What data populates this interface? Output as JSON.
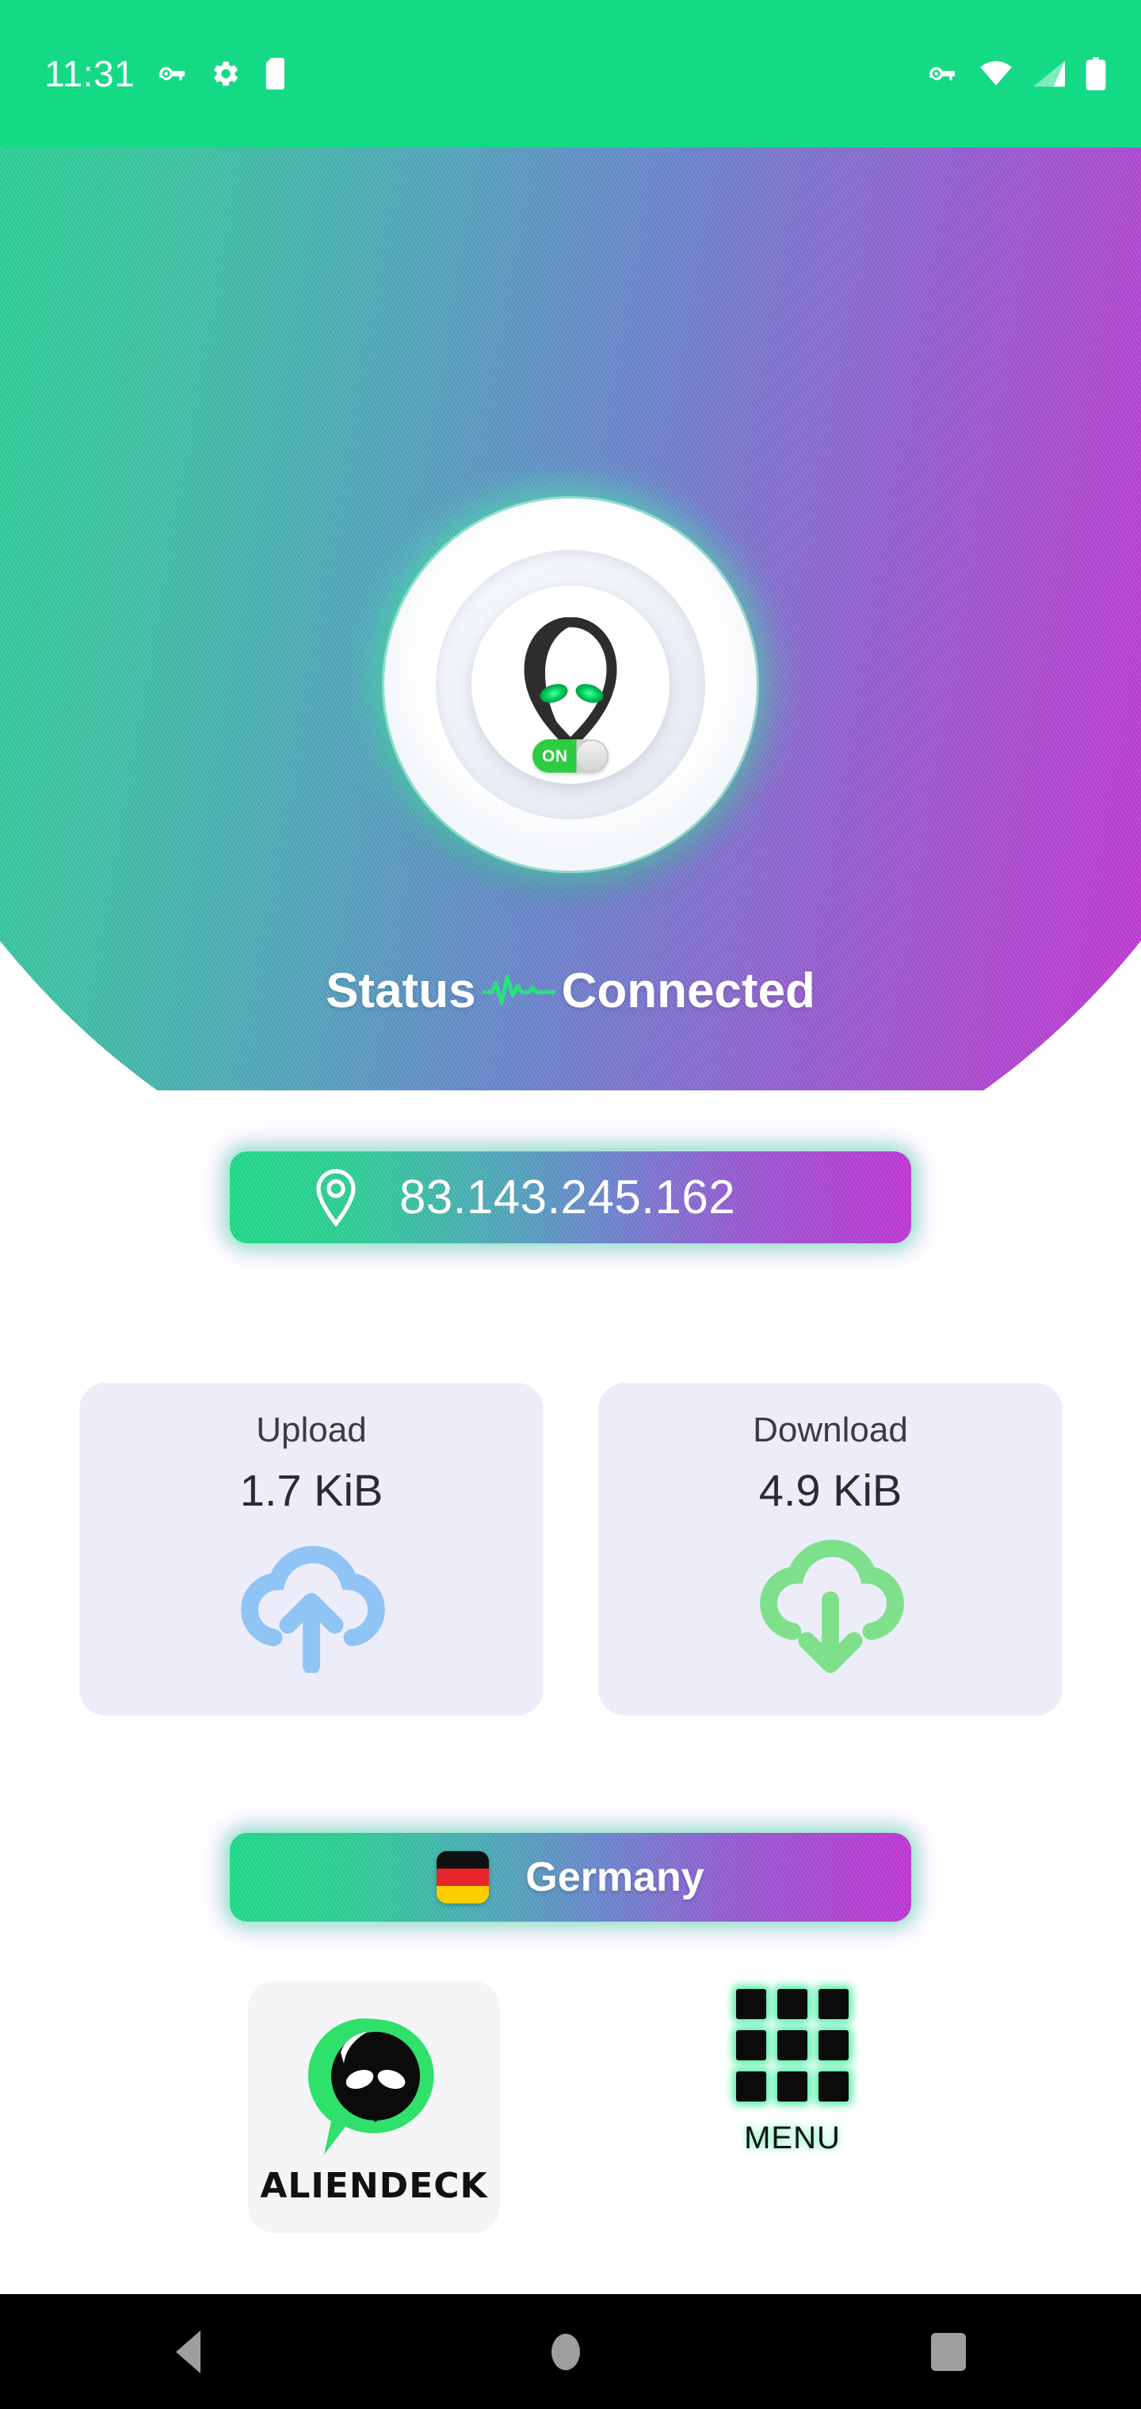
{
  "status_bar": {
    "time": "11:31",
    "left_icons": [
      "vpn-key-icon",
      "settings-gear-icon",
      "sd-card-icon"
    ],
    "right_icons": [
      "vpn-key-icon",
      "wifi-icon",
      "cellular-signal-icon",
      "battery-icon"
    ],
    "background_color": "#14DA86"
  },
  "hero": {
    "gradient_start": "#1FDD8A",
    "gradient_end": "#CE2ED8",
    "power_button": {
      "icon": "alien-head-icon",
      "toggle_state": "ON",
      "toggle_color": "#2ECC40"
    },
    "status_label": "Status",
    "status_separator_icon": "pulse-heartbeat-icon",
    "status_value": "Connected",
    "status_color": "#2BE07F"
  },
  "ip_address": {
    "icon": "location-pin-icon",
    "value": "83.143.245.162"
  },
  "stats": [
    {
      "name": "upload",
      "title": "Upload",
      "value": "1.7 KiB",
      "icon": "cloud-upload-icon",
      "icon_color": "#8FC4F5"
    },
    {
      "name": "download",
      "title": "Download",
      "value": "4.9 KiB",
      "icon": "cloud-download-icon",
      "icon_color": "#7FE08C"
    }
  ],
  "card_background": "#EDEDFA",
  "country": {
    "name": "Germany",
    "flag_icon": "germany-flag-icon",
    "flag_colors": [
      "#111111",
      "#E8252A",
      "#FFCE00"
    ]
  },
  "bottom_actions": {
    "brand": {
      "label": "ALIENDECK",
      "icon": "aliendeck-logo-icon",
      "bubble_color": "#2FE06B"
    },
    "menu": {
      "label": "MENU",
      "icon": "grid-menu-icon",
      "glow_color": "#2DEB96"
    }
  },
  "nav_bar": {
    "buttons": [
      "back-button",
      "home-button",
      "recents-button"
    ],
    "icon_color": "#9e9e9e",
    "background_color": "#000000"
  }
}
